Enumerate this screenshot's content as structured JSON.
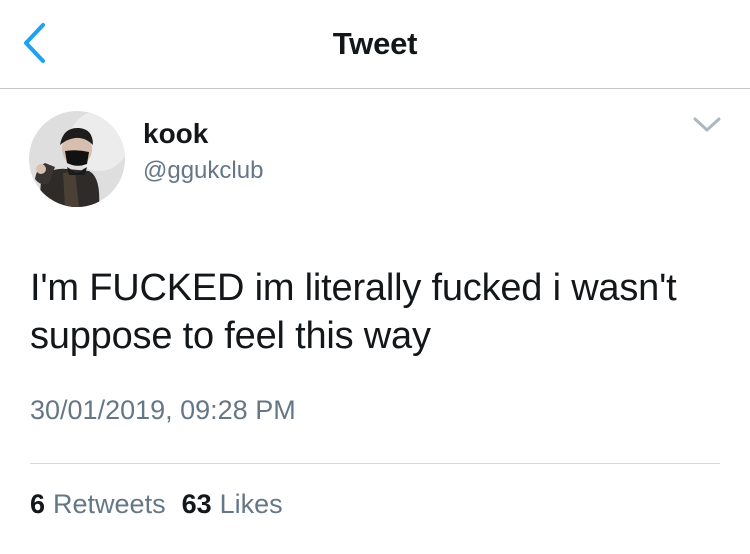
{
  "navbar": {
    "title": "Tweet",
    "back_icon": "chevron-left-icon",
    "accent_color": "#1da1f2"
  },
  "tweet": {
    "author": {
      "display_name": "kook",
      "handle": "@ggukclub"
    },
    "menu_icon": "chevron-down-icon",
    "text": "I'm FUCKED im literally fucked i wasn't suppose to feel this way",
    "timestamp": "30/01/2019, 09:28 PM",
    "stats": {
      "retweets_count": "6",
      "retweets_label": "Retweets",
      "likes_count": "63",
      "likes_label": "Likes"
    }
  }
}
